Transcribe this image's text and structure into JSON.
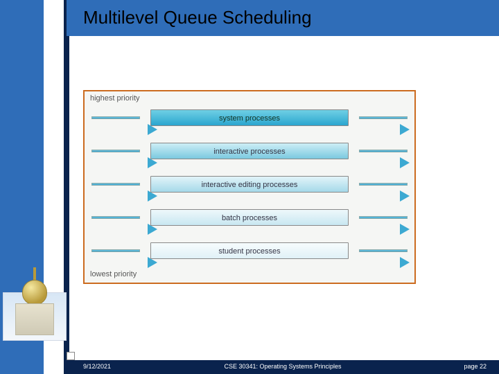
{
  "header": {
    "title": "Multilevel Queue Scheduling"
  },
  "diagram": {
    "top_label": "highest priority",
    "bottom_label": "lowest priority",
    "queues": [
      "system processes",
      "interactive processes",
      "interactive editing processes",
      "batch processes",
      "student processes"
    ]
  },
  "footer": {
    "date": "9/12/2021",
    "course": "CSE 30341: Operating Systems Principles",
    "page": "page 22"
  }
}
